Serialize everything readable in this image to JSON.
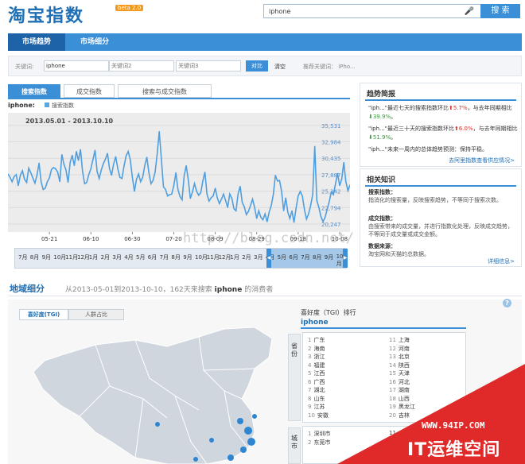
{
  "header": {
    "logo": "淘宝指数",
    "beta": "beta 2.0",
    "search_value": "iphone",
    "search_button": "搜 索"
  },
  "nav": {
    "tabs": [
      "市场趋势",
      "市场细分"
    ]
  },
  "keywords": {
    "label": "关键词:",
    "kw1": "iphone",
    "kw2_placeholder": "关键词2",
    "kw3_placeholder": "关键词3",
    "compare": "对比",
    "clear": "清空",
    "recommend": "推荐关键词： iPho..."
  },
  "subtabs": [
    "搜索指数",
    "成交指数",
    "搜索与成交指数"
  ],
  "chart_legend": {
    "keyword": "iphone:",
    "series": "搜索指数"
  },
  "chart_data": {
    "type": "line",
    "title": "2013.05.01 - 2013.10.10",
    "yticks": [
      "35,531",
      "32,984",
      "30,435",
      "27,887",
      "25,342",
      "22,794",
      "20,247"
    ],
    "ylim": [
      19500,
      36500
    ],
    "xticks": [
      "05-21",
      "06-10",
      "06-30",
      "07-20",
      "08-09",
      "08-29",
      "09-18",
      "10-08"
    ],
    "start": "2013-05-01",
    "series": [
      {
        "values": [
          28000,
          27500,
          26800,
          27600,
          27900,
          26200,
          27800,
          28500,
          27200,
          26700,
          28900,
          28200,
          27400,
          26600,
          27800,
          29700,
          26800,
          25600,
          25800,
          26800,
          27400,
          28700,
          29000,
          28800,
          28300,
          26800,
          31000,
          29500,
          28600,
          26700,
          29800,
          30900,
          29300,
          31500,
          30100,
          31800,
          28400,
          26500,
          26700,
          27900,
          28800,
          30200,
          31700,
          28400,
          27300,
          28600,
          29600,
          30300,
          31200,
          28800,
          27800,
          29600,
          30700,
          28800,
          27500,
          27300,
          29200,
          30800,
          31500,
          30200,
          27500,
          25300,
          27200,
          28000,
          26800,
          27500,
          29300,
          30600,
          28200,
          26500,
          27000,
          28300,
          31100,
          34600,
          30400,
          26000,
          25600,
          24600,
          24800,
          24900,
          26200,
          28200,
          25600,
          24500,
          24000,
          27700,
          29300,
          27100,
          24200,
          25200,
          26500,
          25300,
          24700,
          25100,
          26900,
          28300,
          24900,
          23800,
          24300,
          24600,
          25800,
          24300,
          23400,
          24100,
          24900,
          23900,
          22800,
          24900,
          24200,
          22600,
          22300,
          24900,
          26100,
          23600,
          22900,
          21700,
          22200,
          23100,
          24100,
          22800,
          21100,
          22300,
          21300,
          20900,
          21800,
          20600,
          22100,
          23100,
          24800,
          27800,
          26900,
          27000,
          25300,
          22300,
          24300,
          22100,
          21100,
          22300,
          20500,
          22700,
          24600,
          25300,
          24600,
          22500,
          21000,
          21800,
          23100,
          24800,
          32300,
          23900,
          22800,
          21400,
          20600,
          21300,
          22500,
          23700,
          25200,
          24800,
          26500,
          28100,
          26200,
          27200,
          29800,
          26800,
          25400,
          26300
        ]
      }
    ]
  },
  "timeline": [
    "7月",
    "8月",
    "9月",
    "10月",
    "11月",
    "12月",
    "1月",
    "2月",
    "3月",
    "4月",
    "5月",
    "6月",
    "7月",
    "8月",
    "9月",
    "10月",
    "11月",
    "12月",
    "1月",
    "2月",
    "3月",
    "4月",
    "5月",
    "6月",
    "7月",
    "8月",
    "9月",
    "10月"
  ],
  "trend_panel": {
    "title": "趋势简报",
    "lines": [
      {
        "pre": "\"iph...\"最近七天的搜索指数环比",
        "v1": "5.7%",
        "d1": "up",
        "mid": "，与去年同期相比",
        "v2": "39.9%",
        "d2": "down",
        "post": "。"
      },
      {
        "pre": "\"iph...\"最近三十天的搜索指数环比",
        "v1": "6.0%",
        "d1": "up",
        "mid": "，与去年同期相比",
        "v2": "51.9%",
        "d2": "down",
        "post": "。"
      }
    ],
    "predict": "\"iph...\"未来一周内的总体趋势预测：保持平稳。",
    "more": "去阿里指数查看供应情况>"
  },
  "know_panel": {
    "title": "相关知识",
    "search_head": "搜索指数：",
    "search_text": "指消化的搜索量，反映搜索趋势，不等同于搜索次数。",
    "deal_head": "成交指数：",
    "deal_text": "由搜索带来的成交量，并进行指数化处理，反映成交趋势，不等同于成交量或成交金额。",
    "source_head": "数据来源：",
    "source_text": "淘宝网和天猫的总数据。",
    "more": "详细信息>"
  },
  "region": {
    "title": "地域细分",
    "sub_pre": "从2013-05-01到2013-10-10，162天来搜索",
    "sub_kw": "iphone",
    "sub_post": "的消费者",
    "tab_tgi": "喜好度(TGI)",
    "tab_share": "人群占比",
    "rank_title": "喜好度（TGI）排行",
    "rank_kw": "iphone",
    "prov_tab": "省份",
    "city_tab": "城市",
    "provinces": [
      "广东",
      "海南",
      "浙江",
      "福建",
      "江西",
      "广西",
      "湖北",
      "山东",
      "江苏",
      "安徽",
      "上海",
      "河南",
      "北京",
      "陕西",
      "天津",
      "河北",
      "湖南",
      "山西",
      "黑龙江",
      "吉林"
    ],
    "cities": [
      "深圳市",
      "东莞市"
    ],
    "city_right": [
      "11",
      "12"
    ]
  },
  "watermark": {
    "url": "WWW.94IP.COM",
    "text": "IT运维空间",
    "blog": "http://blog.csdn.net/"
  }
}
